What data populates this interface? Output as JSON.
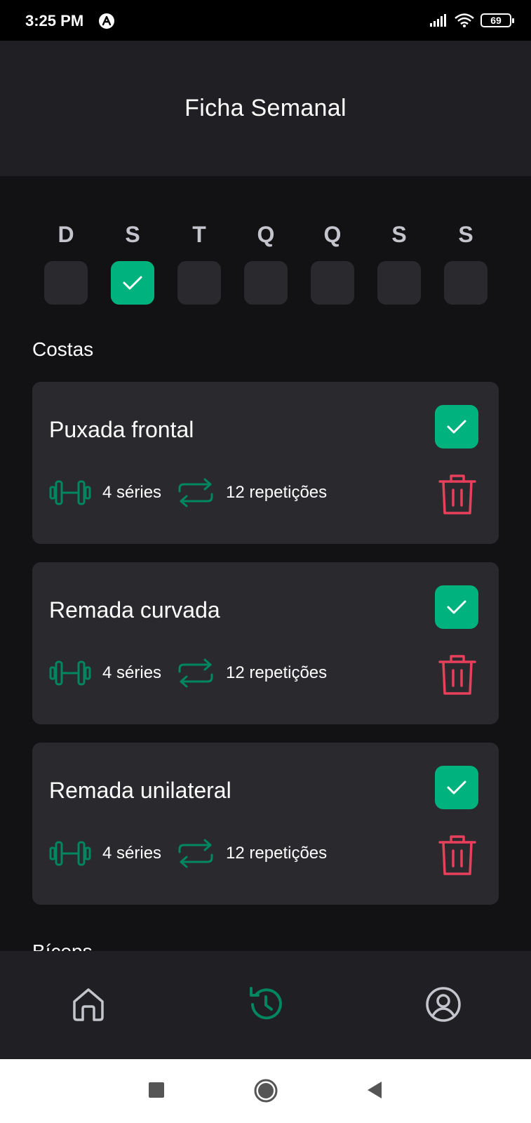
{
  "status": {
    "time": "3:25 PM",
    "battery": "69"
  },
  "header": {
    "title": "Ficha Semanal"
  },
  "days": [
    {
      "letter": "D",
      "checked": false
    },
    {
      "letter": "S",
      "checked": true
    },
    {
      "letter": "T",
      "checked": false
    },
    {
      "letter": "Q",
      "checked": false
    },
    {
      "letter": "Q",
      "checked": false
    },
    {
      "letter": "S",
      "checked": false
    },
    {
      "letter": "S",
      "checked": false
    }
  ],
  "sections": [
    {
      "title": "Costas",
      "exercises": [
        {
          "name": "Puxada frontal",
          "series": "4 séries",
          "reps": "12 repetições",
          "done": true
        },
        {
          "name": "Remada curvada",
          "series": "4 séries",
          "reps": "12 repetições",
          "done": true
        },
        {
          "name": "Remada unilateral",
          "series": "4 séries",
          "reps": "12 repetições",
          "done": true
        }
      ]
    },
    {
      "title": "Bíceps"
    }
  ],
  "tabs": [
    {
      "icon": "home-icon",
      "active": false
    },
    {
      "icon": "history-icon",
      "active": true
    },
    {
      "icon": "profile-icon",
      "active": false
    }
  ],
  "colors": {
    "accent": "#00b37e",
    "danger": "#e83f5b",
    "card": "#29292e",
    "background": "#121214",
    "header": "#202024"
  }
}
